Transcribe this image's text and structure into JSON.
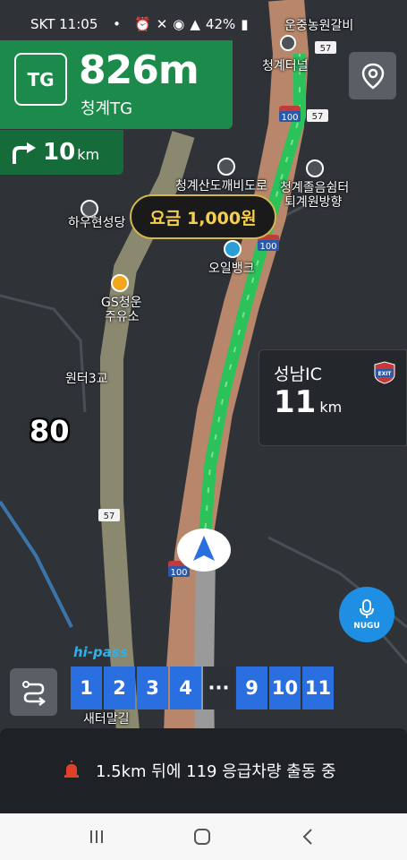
{
  "status_bar": {
    "carrier": "SKT",
    "time": "11:05",
    "battery": "42%"
  },
  "guidance": {
    "badge": "TG",
    "distance": "826m",
    "name": "청계TG"
  },
  "next_turn": {
    "distance": "10",
    "unit": "km"
  },
  "toll": {
    "label": "요금 1,000원"
  },
  "exit_info": {
    "name": "성남IC",
    "distance": "11",
    "unit": "km",
    "badge": "EXIT"
  },
  "speed_limit": "80",
  "map_labels": {
    "top_right": "운중농원갈비",
    "tunnel": "청계터널",
    "shop": "청계산도깨비도로",
    "rest": "청계졸음쉼터",
    "rest2": "퇴계원방향",
    "church": "하우현성당",
    "bank": "오일뱅크",
    "gas1": "GS청운",
    "gas2": "주유소",
    "bridge": "원터3교",
    "village": "새터말길"
  },
  "road_shields": [
    "57",
    "100",
    "57",
    "100",
    "100",
    "57",
    "100"
  ],
  "hipass_label": "hi-pass",
  "lanes": [
    "1",
    "2",
    "3",
    "4",
    "···",
    "9",
    "10",
    "11"
  ],
  "nugu": {
    "label": "NUGU"
  },
  "alert": {
    "text": "1.5km 뒤에 119 응급차량 출동 중"
  },
  "colors": {
    "guidance_green": "#1c8a4b",
    "route_green": "#2bc25a",
    "lane_blue": "#2a6fe0",
    "toll_gold": "#f5cf4f",
    "nugu_blue": "#1e8fe2"
  }
}
